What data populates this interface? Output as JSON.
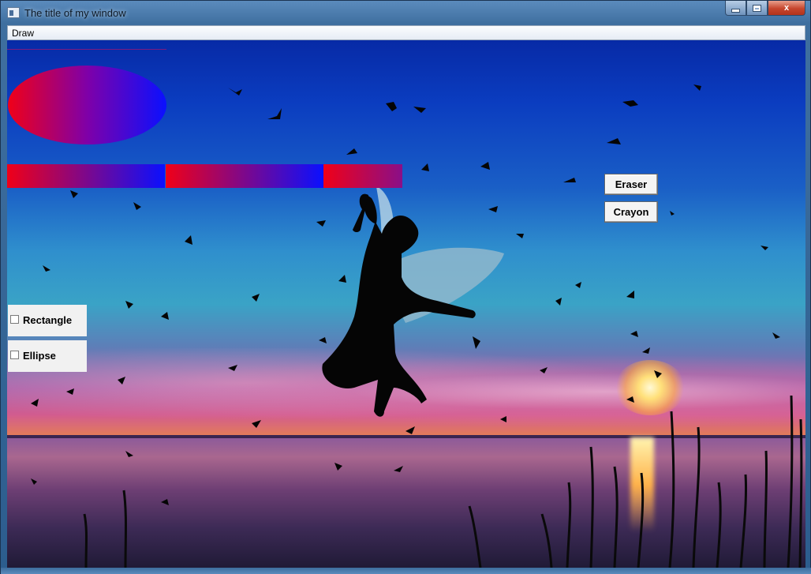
{
  "window": {
    "title": "The title of my window",
    "buttons": {
      "minimize_icon": "minimize-icon",
      "maximize_icon": "maximize-icon",
      "close_icon": "close-icon",
      "close_glyph": "x"
    }
  },
  "menu": {
    "items": [
      {
        "label": "Draw"
      }
    ]
  },
  "canvas": {
    "shape_gradient": {
      "from": "#f00018",
      "to": "#0a10ff"
    }
  },
  "tools": {
    "eraser_label": "Eraser",
    "crayon_label": "Crayon"
  },
  "shapes": {
    "rectangle_label": "Rectangle",
    "ellipse_label": "Ellipse",
    "rectangle_checked": false,
    "ellipse_checked": false
  }
}
